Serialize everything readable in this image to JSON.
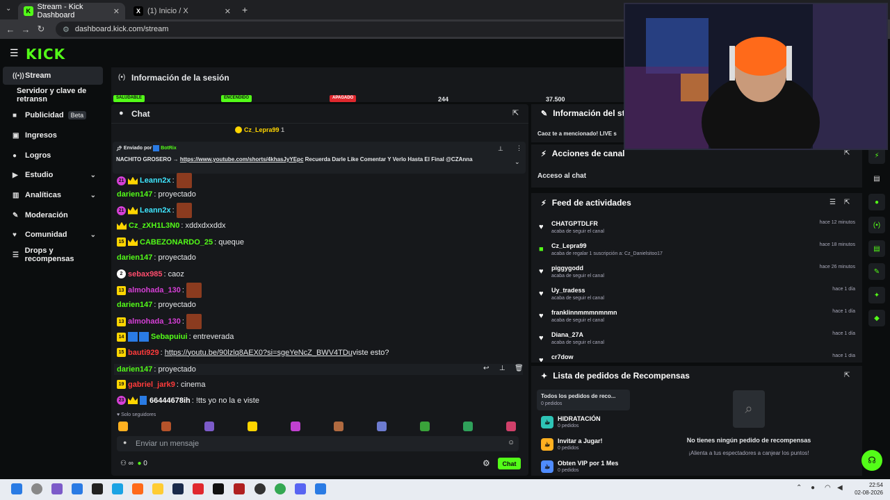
{
  "browser": {
    "tabs": [
      {
        "title": "Stream - Kick Dashboard",
        "active": true
      },
      {
        "title": "(1) Inicio / X",
        "active": false
      }
    ],
    "url": "dashboard.kick.com/stream"
  },
  "brand": {
    "logo": "KICK",
    "accent": "#53fc18"
  },
  "sidebar": {
    "items": [
      {
        "label": "Stream",
        "icon": "broadcast-icon"
      },
      {
        "label": "Servidor y clave de retransn"
      },
      {
        "label": "Publicidad",
        "badge": "Beta",
        "icon": "megaphone-icon"
      },
      {
        "label": "Ingresos",
        "icon": "wallet-icon"
      },
      {
        "label": "Logros",
        "icon": "trophy-icon"
      },
      {
        "label": "Estudio",
        "icon": "studio-icon"
      },
      {
        "label": "Analíticas",
        "icon": "chart-icon"
      },
      {
        "label": "Moderación",
        "icon": "wrench-icon"
      },
      {
        "label": "Comunidad",
        "icon": "users-icon"
      },
      {
        "label": "Drops y recompensas",
        "icon": "gift-icon"
      }
    ]
  },
  "session": {
    "title": "Información de la sesión",
    "pills": [
      "SALUDABLE",
      "ENCENDIDO",
      "APAGADO"
    ],
    "values": [
      "244",
      "37.500"
    ]
  },
  "chat": {
    "title": "Chat",
    "top_user": "Cz_Lepra99",
    "top_count": "1",
    "pinned": {
      "sent_by_label": "Enviado por",
      "sender": "BotRix",
      "text_prefix": "NACHITO GROSERO",
      "link": "https://www.youtube.com/shorts/4khasJyYEpc",
      "text_suffix": "Recuerda Darle Like Comentar Y Verlo Hasta El Final",
      "mention": "@CZAnna"
    },
    "messages": [
      {
        "badge": "21",
        "user": "Leann2x",
        "color": "#3ee6ff",
        "text": ":",
        "emote": true
      },
      {
        "user": "darien147",
        "color": "#53fc18",
        "text": ": proyectado"
      },
      {
        "badge": "21",
        "user": "Leann2x",
        "color": "#3ee6ff",
        "text": ":",
        "emote": true
      },
      {
        "user": "Cz_zXH1L3N0",
        "color": "#53fc18",
        "text": ": xddxdxxddx"
      },
      {
        "badge": "15",
        "user": "CABEZONARDO_25",
        "color": "#53fc18",
        "text": ": queque"
      },
      {
        "user": "darien147",
        "color": "#53fc18",
        "text": ": proyectado"
      },
      {
        "badge": "2",
        "user": "sebax985",
        "color": "#ff4d6d",
        "text": ": caoz"
      },
      {
        "badge": "13",
        "user": "almohada_130",
        "color": "#d63fd6",
        "text": ":",
        "emote": true
      },
      {
        "user": "darien147",
        "color": "#53fc18",
        "text": ": proyectado"
      },
      {
        "badge": "13",
        "user": "almohada_130",
        "color": "#d63fd6",
        "text": ":",
        "emote": true
      },
      {
        "badge": "14",
        "user": "Sebapuiui",
        "color": "#53fc18",
        "text": ": entreverada"
      },
      {
        "badge": "15",
        "user": "bauti929",
        "color": "#ff3b3b",
        "link": "https://youtu.be/90lzlq8AEX0?si=sgeYeNcZ_BWV4TDu",
        "text": " viste esto?"
      },
      {
        "user": "darien147",
        "color": "#53fc18",
        "text": ": proyectado"
      },
      {
        "badge": "19",
        "user": "gabriel_jark9",
        "color": "#ff3b3b",
        "text": ": cinema"
      },
      {
        "badge": "23",
        "user": "66444678ih",
        "color": "#ffffff",
        "text": ": !tts yo no la e viste"
      }
    ],
    "followers_only": "Solo seguidores",
    "input_placeholder": "Enviar un mensaje",
    "viewer_count": "0",
    "send_label": "Chat"
  },
  "stream_info": {
    "title": "Información del str",
    "notice": "Caoz te a mencionado! LIVE s"
  },
  "channel_actions": {
    "title": "Acciones de canal",
    "chat_access": "Acceso al chat"
  },
  "activity_feed": {
    "title": "Feed de actividades",
    "items": [
      {
        "name": "CHATGPTDLFR",
        "desc": "acaba de seguir el canal",
        "time": "hace 12 minutos"
      },
      {
        "name": "Cz_Lepra99",
        "desc": "acaba de regalar 1 suscripción a: Cz_Danielsitoo17",
        "time": "hace 18 minutos"
      },
      {
        "name": "piggygodd",
        "desc": "acaba de seguir el canal",
        "time": "hace 26 minutos"
      },
      {
        "name": "Uy_tradess",
        "desc": "acaba de seguir el canal",
        "time": "hace 1 día"
      },
      {
        "name": "franklinnmmmnmnmn",
        "desc": "acaba de seguir el canal",
        "time": "hace 1 día"
      },
      {
        "name": "Diana_27A",
        "desc": "acaba de seguir el canal",
        "time": "hace 1 día"
      },
      {
        "name": "cr7dow",
        "desc": "",
        "time": "hace 1 día"
      }
    ]
  },
  "rewards": {
    "title": "Lista de pedidos de Recompensas",
    "all": {
      "name": "Todos los pedidos de reco...",
      "count": "0 pedidos"
    },
    "items": [
      {
        "name": "HIDRATACIÓN",
        "count": "0 pedidos",
        "color": "#2ec4b6"
      },
      {
        "name": "Invitar a Jugar!",
        "count": "0 pedidos",
        "color": "#ffb020"
      },
      {
        "name": "Obten VIP por 1 Mes",
        "count": "0 pedidos",
        "color": "#4f8cff"
      }
    ],
    "empty_title": "No tienes ningún pedido de recompensas",
    "empty_sub": "¡Alienta a tus espectadores a canjear los puntos!"
  },
  "taskbar": {
    "time": "22:54",
    "date": "02-08-2026"
  }
}
